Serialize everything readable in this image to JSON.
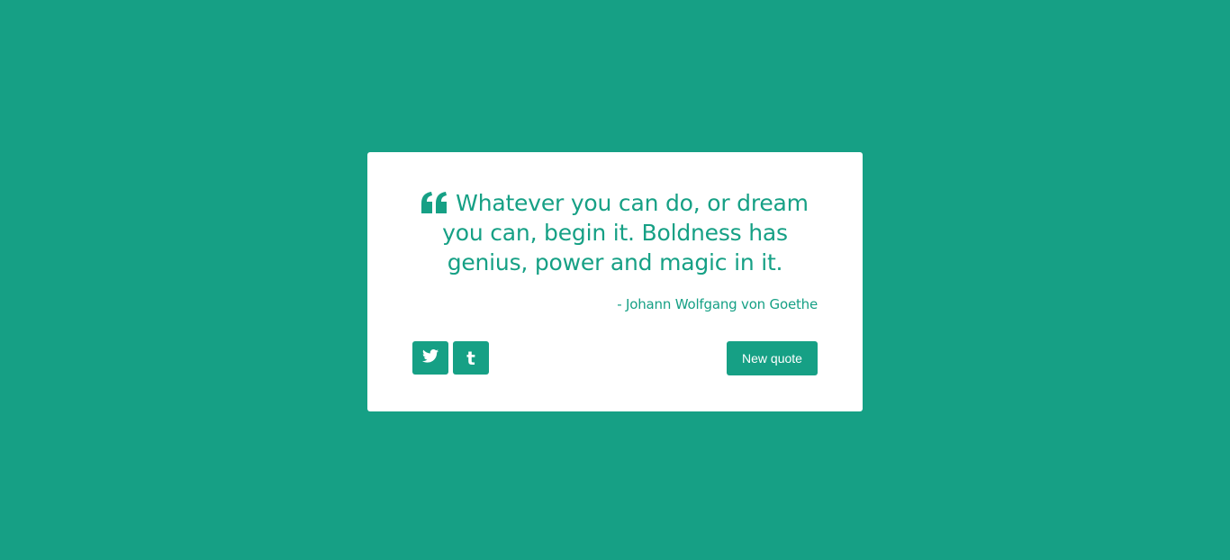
{
  "quote": {
    "text": "Whatever you can do, or dream you can, begin it. Boldness has genius, power and magic in it.",
    "author": "- Johann Wolfgang von Goethe",
    "icon": "quote-left-icon"
  },
  "buttons": {
    "tweet_icon": "twitter-icon",
    "tumblr_icon": "tumblr-icon",
    "tumblr_glyph": "t",
    "new_quote_label": "New quote"
  },
  "colors": {
    "accent": "#16a085",
    "card_background": "#ffffff"
  }
}
